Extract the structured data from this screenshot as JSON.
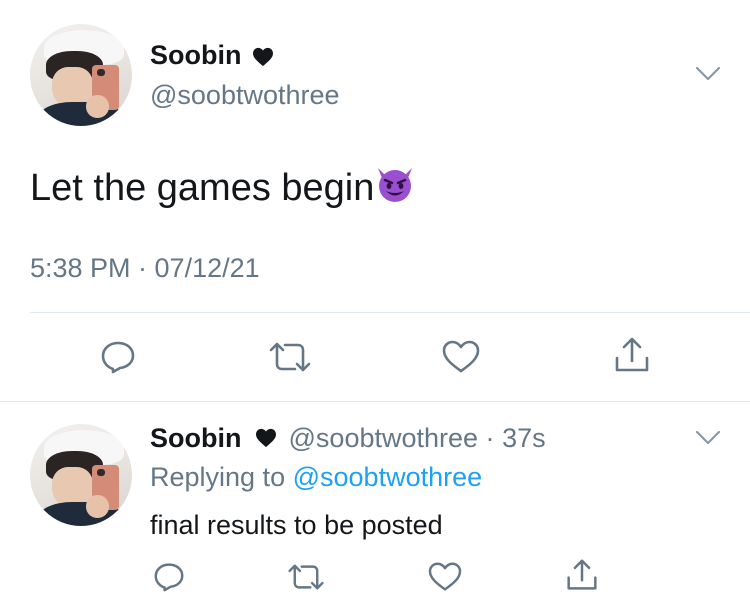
{
  "tweet": {
    "author_name": "Soobin",
    "author_handle": "@soobtwothree",
    "text": "Let the games begin",
    "timestamp": "5:38 PM · 07/12/21"
  },
  "reply": {
    "author_name": "Soobin",
    "author_handle": "@soobtwothree",
    "separator": "·",
    "age": "37s",
    "replying_to_label": "Replying to",
    "replying_to_handle": "@soobtwothree",
    "text": "final results to be posted"
  },
  "icons": {
    "name_badge": "black-heart-icon",
    "emoji": "smiling-imp-emoji",
    "menu": "chevron-down-icon",
    "actions": [
      "reply-icon",
      "retweet-icon",
      "like-icon",
      "share-icon"
    ]
  },
  "colors": {
    "text": "#14171a",
    "secondary": "#657786",
    "link": "#1da1f2",
    "divider": "#e1e8ed",
    "emoji": "#9a4fd1"
  }
}
